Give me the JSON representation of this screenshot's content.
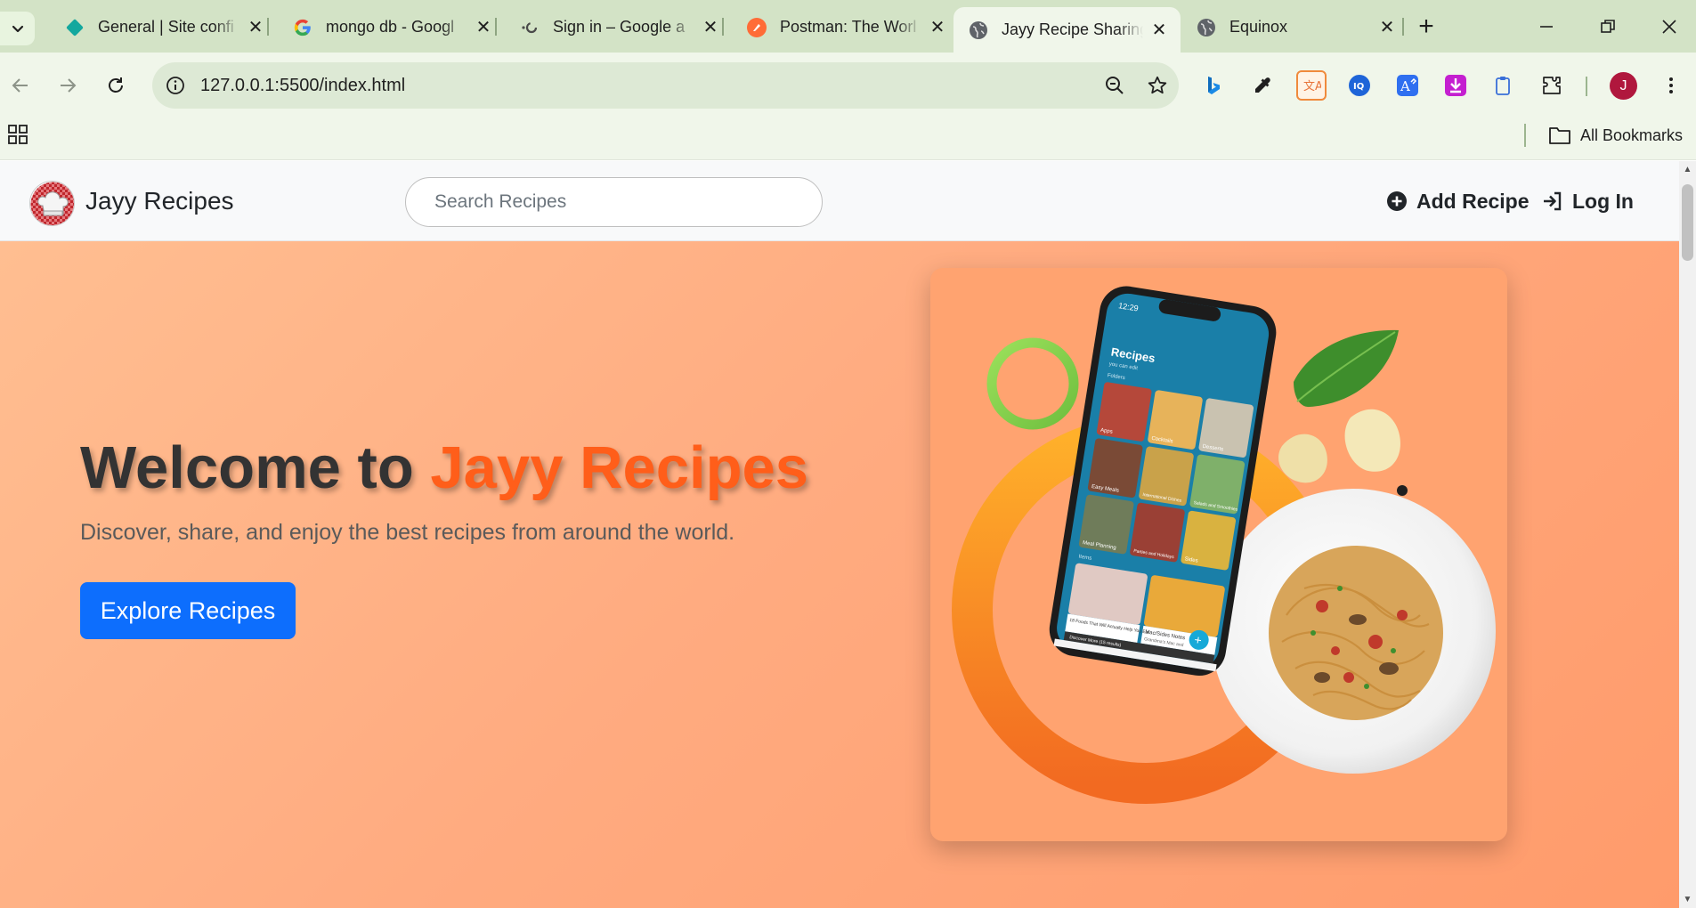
{
  "browser": {
    "tabs": [
      {
        "title": "General | Site confi",
        "icon": "diamond-favicon-icon",
        "active": false
      },
      {
        "title": "mongo db - Googl",
        "icon": "google-favicon-icon",
        "active": false
      },
      {
        "title": "Sign in – Google a",
        "icon": "loading-favicon-icon",
        "active": false
      },
      {
        "title": "Postman: The Worl",
        "icon": "postman-favicon-icon",
        "active": false
      },
      {
        "title": "Jayy Recipe Sharing",
        "icon": "globe-favicon-icon",
        "active": true
      },
      {
        "title": "Equinox",
        "icon": "globe-favicon-icon",
        "active": false
      }
    ],
    "url": "127.0.0.1:5500/index.html",
    "bookmarks_label": "All Bookmarks",
    "profile_initial": "J",
    "colors": {
      "frame": "#d3e3c6",
      "toolbar": "#f0f6ea",
      "omnibox": "#dde9d5",
      "profile": "#b0173d"
    }
  },
  "site": {
    "brand": "Jayy Recipes",
    "search_placeholder": "Search Recipes",
    "nav": {
      "add_recipe": "Add Recipe",
      "login": "Log In"
    },
    "hero": {
      "title_prefix": "Welcome to ",
      "title_accent": "Jayy Recipes",
      "subtitle": "Discover, share, and enjoy the best recipes from around the world.",
      "cta": "Explore Recipes"
    },
    "colors": {
      "accent": "#ff5e1a",
      "primary_button": "#0d6efd",
      "hero_start": "#ffbe91",
      "hero_end": "#ff9b6b"
    },
    "illustration": {
      "phone_time": "12:29",
      "phone_heading": "Recipes",
      "phone_subheading": "you can edit",
      "phone_section": "Folders",
      "tiles": [
        "Apps",
        "Cocktails",
        "Desserts",
        "Easy Meals",
        "International Dishes",
        "Salads and Smoothies",
        "Meal Planning",
        "Parties and Holidays",
        "Sides"
      ],
      "phone_section_2": "Items",
      "card_1": "18 Foods That Will Actually Help You Eat",
      "card_2": "Mac/Sides Notes",
      "card_2_sub": "Grandma's Mac and",
      "discover_bar": "Discover More (15 results)"
    }
  }
}
